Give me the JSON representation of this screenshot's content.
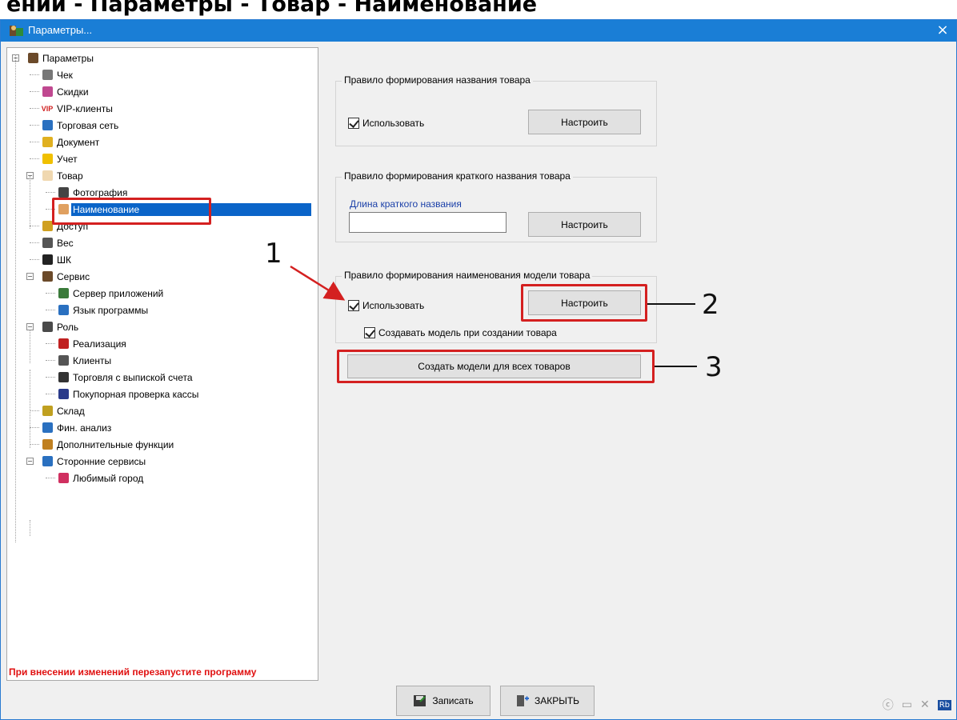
{
  "doc_header": "ении - Параметры - Товар - Наименование",
  "window": {
    "title": "Параметры...",
    "close_glyph": "×"
  },
  "tree": {
    "items": [
      {
        "label": "Параметры",
        "icon": "settings-icon",
        "level": 0,
        "expander": "−"
      },
      {
        "label": "Чек",
        "icon": "receipt-icon",
        "level": 1
      },
      {
        "label": "Скидки",
        "icon": "discount-icon",
        "level": 1
      },
      {
        "label": "VIP-клиенты",
        "icon": "vip-icon",
        "level": 1,
        "icon_text": "VIP"
      },
      {
        "label": "Торговая сеть",
        "icon": "network-icon",
        "level": 1
      },
      {
        "label": "Документ",
        "icon": "document-icon",
        "level": 1
      },
      {
        "label": "Учет",
        "icon": "warning-icon",
        "level": 1
      },
      {
        "label": "Товар",
        "icon": "product-icon",
        "level": 1,
        "expander": "−"
      },
      {
        "label": "Фотография",
        "icon": "camera-icon",
        "level": 2
      },
      {
        "label": "Наименование",
        "icon": "name-icon",
        "level": 2,
        "selected": true
      },
      {
        "label": "Доступ",
        "icon": "key-icon",
        "level": 1
      },
      {
        "label": "Вес",
        "icon": "weight-icon",
        "level": 1
      },
      {
        "label": "ШК",
        "icon": "barcode-icon",
        "level": 1
      },
      {
        "label": "Сервис",
        "icon": "service-icon",
        "level": 1,
        "expander": "−"
      },
      {
        "label": "Сервер приложений",
        "icon": "server-icon",
        "level": 2
      },
      {
        "label": "Язык программы",
        "icon": "globe-icon",
        "level": 2
      },
      {
        "label": "Роль",
        "icon": "role-icon",
        "level": 1,
        "expander": "−"
      },
      {
        "label": "Реализация",
        "icon": "arrow-up-icon",
        "level": 2
      },
      {
        "label": "Клиенты",
        "icon": "clients-icon",
        "level": 2
      },
      {
        "label": "Торговля с выпиской счета",
        "icon": "invoice-icon",
        "level": 2
      },
      {
        "label": "Покупорная проверка кассы",
        "icon": "cashbox-check-icon",
        "level": 2
      },
      {
        "label": "Склад",
        "icon": "warehouse-icon",
        "level": 1
      },
      {
        "label": "Фин. анализ",
        "icon": "finance-icon",
        "level": 1
      },
      {
        "label": "Дополнительные функции",
        "icon": "tools-icon",
        "level": 1
      },
      {
        "label": "Сторонние сервисы",
        "icon": "services-icon",
        "level": 1,
        "expander": "−"
      },
      {
        "label": "Любимый город",
        "icon": "city-icon",
        "level": 2
      }
    ]
  },
  "groups": {
    "name_rule": {
      "legend": "Правило формирования названия товара",
      "checkbox_label": "Использовать",
      "button_label": "Настроить"
    },
    "short_name_rule": {
      "legend": "Правило формирования краткого названия товара",
      "field_label": "Длина краткого названия",
      "field_value": "",
      "button_label": "Настроить"
    },
    "model_rule": {
      "legend": "Правило формирования наименования модели товара",
      "checkbox_label": "Использовать",
      "button_label": "Настроить",
      "create_checkbox_label": "Создавать модель при создании товара",
      "create_all_button_label": "Создать модели для всех товаров"
    }
  },
  "callouts": {
    "one": "1",
    "two": "2",
    "three": "3"
  },
  "status": {
    "warning": "При внесении изменений перезапустите программу"
  },
  "bottom": {
    "save_label": "Записать",
    "close_label": "ЗАКРЫТЬ"
  },
  "colors": {
    "titlebar": "#1a7ed6",
    "selection": "#0a64c8",
    "annotation": "#d42020",
    "warning": "#e01010"
  }
}
